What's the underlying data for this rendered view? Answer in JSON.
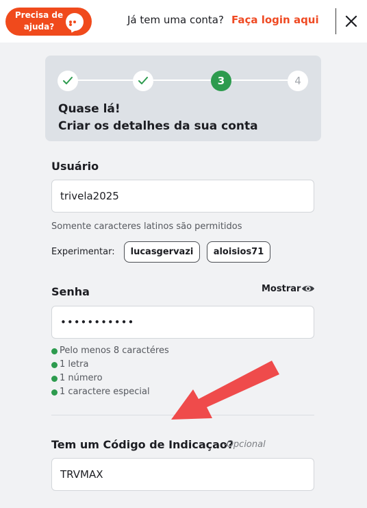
{
  "header": {
    "help_label": "Precisa de ajuda?",
    "login_question": "Já tem uma conta?",
    "login_link": "Faça login aqui"
  },
  "steps": {
    "items": [
      {
        "label": "",
        "state": "done"
      },
      {
        "label": "",
        "state": "done"
      },
      {
        "label": "3",
        "state": "current"
      },
      {
        "label": "4",
        "state": "todo"
      }
    ],
    "title_line1": "Quase lá!",
    "title_line2": "Criar os detalhes da sua conta"
  },
  "username": {
    "label": "Usuário",
    "value": "trivela2025",
    "hint": "Somente caracteres latinos são permitidos",
    "try_label": "Experimentar:",
    "suggestions": [
      "lucasgervazi",
      "aloisios71"
    ]
  },
  "password": {
    "label": "Senha",
    "show_label": "Mostrar",
    "value": "•••••••••••",
    "rules": [
      "Pelo menos 8 caractéres",
      "1 letra",
      "1 número",
      "1 caractere especial"
    ]
  },
  "referral": {
    "label": "Tem um Código de Indicaçao?",
    "optional": "-Opcional",
    "value": "TRVMAX"
  },
  "colors": {
    "brand": "#f04a1c",
    "success": "#2d9b4e",
    "arrow": "#ef4b4b"
  }
}
